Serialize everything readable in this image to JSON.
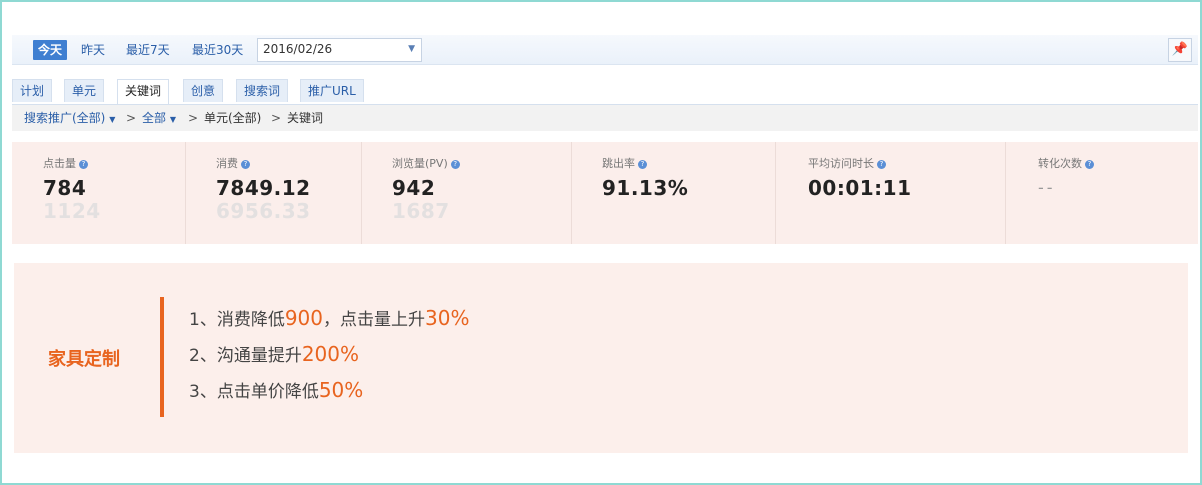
{
  "datebar": {
    "today": "今天",
    "yesterday": "昨天",
    "last7": "最近7天",
    "last30": "最近30天",
    "date_value": "2016/02/26"
  },
  "tabs": [
    {
      "label": "计划"
    },
    {
      "label": "单元"
    },
    {
      "label": "关键词"
    },
    {
      "label": "创意"
    },
    {
      "label": "搜索词"
    },
    {
      "label": "推广URL"
    }
  ],
  "active_tab": "关键词",
  "breadcrumb": {
    "root": "搜索推广(全部)",
    "level2": "全部",
    "level3": "单元(全部)",
    "level4": "关键词",
    "sep": ">"
  },
  "metrics": [
    {
      "label": "点击量",
      "value": "784",
      "compare": "1124"
    },
    {
      "label": "消费",
      "value": "7849.12",
      "compare": "6956.33"
    },
    {
      "label": "浏览量(PV)",
      "value": "942",
      "compare": "1687"
    },
    {
      "label": "跳出率",
      "value": "91.13%",
      "compare": ""
    },
    {
      "label": "平均访问时长",
      "value": "00:01:11",
      "compare": ""
    },
    {
      "label": "转化次数",
      "value": "--",
      "compare": ""
    }
  ],
  "promo": {
    "title": "家具定制",
    "line1": {
      "a": "1、消费降低",
      "b": "900",
      "c": "，点击量上升",
      "d": "30%"
    },
    "line2": {
      "a": "2、沟通量提升",
      "b": "200%"
    },
    "line3": {
      "a": "3、点击单价降低",
      "b": "50%"
    }
  },
  "colors": {
    "accent": "#e8641f",
    "link": "#2a5ea8",
    "active_button": "#3f7fd1",
    "metrics_bg": "#fbeeeb",
    "frame_border": "#8fd9d3"
  },
  "icons": {
    "dropdown": "chevron-down-icon",
    "pin": "pin-icon",
    "help": "question-icon"
  }
}
